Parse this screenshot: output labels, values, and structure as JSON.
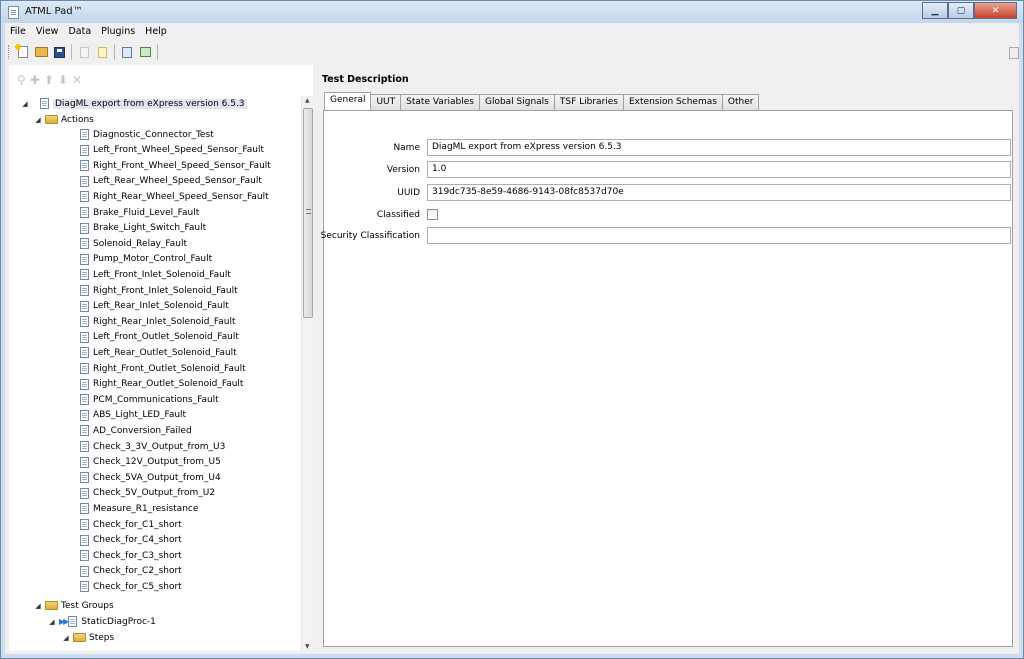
{
  "window": {
    "title": "ATML Pad™"
  },
  "menu": [
    "File",
    "View",
    "Data",
    "Plugins",
    "Help"
  ],
  "toolbar_icons": [
    "new-icon",
    "open-icon",
    "save-icon",
    "document-icon",
    "note-icon",
    "validate-icon",
    "check-icon"
  ],
  "tree_toolbar_icons": [
    "pin-icon",
    "add-icon",
    "move-up-icon",
    "move-down-icon",
    "delete-icon"
  ],
  "tree": {
    "root": "DiagML export from eXpress version 6.5.3",
    "actions_label": "Actions",
    "actions": [
      "Diagnostic_Connector_Test",
      "Left_Front_Wheel_Speed_Sensor_Fault",
      "Right_Front_Wheel_Speed_Sensor_Fault",
      "Left_Rear_Wheel_Speed_Sensor_Fault",
      "Right_Rear_Wheel_Speed_Sensor_Fault",
      "Brake_Fluid_Level_Fault",
      "Brake_Light_Switch_Fault",
      "Solenoid_Relay_Fault",
      "Pump_Motor_Control_Fault",
      "Left_Front_Inlet_Solenoid_Fault",
      "Right_Front_Inlet_Solenoid_Fault",
      "Left_Rear_Inlet_Solenoid_Fault",
      "Right_Rear_Inlet_Solenoid_Fault",
      "Left_Front_Outlet_Solenoid_Fault",
      "Left_Rear_Outlet_Solenoid_Fault",
      "Right_Front_Outlet_Solenoid_Fault",
      "Right_Rear_Outlet_Solenoid_Fault",
      "PCM_Communications_Fault",
      "ABS_Light_LED_Fault",
      "AD_Conversion_Failed",
      "Check_3_3V_Output_from_U3",
      "Check_12V_Output_from_U5",
      "Check_5VA_Output_from_U4",
      "Check_5V_Output_from_U2",
      "Measure_R1_resistance",
      "Check_for_C1_short",
      "Check_for_C4_short",
      "Check_for_C3_short",
      "Check_for_C2_short",
      "Check_for_C5_short"
    ],
    "test_groups_label": "Test Groups",
    "group_item": "StaticDiagProc-1",
    "steps_label": "Steps"
  },
  "detail": {
    "section_title": "Test Description",
    "tabs": [
      "General",
      "UUT",
      "State Variables",
      "Global Signals",
      "TSF Libraries",
      "Extension Schemas",
      "Other"
    ],
    "active_tab": "General",
    "fields": {
      "name_label": "Name",
      "name_value": "DiagML export from eXpress version 6.5.3",
      "version_label": "Version",
      "version_value": "1.0",
      "uuid_label": "UUID",
      "uuid_value": "319dc735-8e59-4686-9143-08fc8537d70e",
      "classified_label": "Classified",
      "classified_checked": false,
      "security_label": "Security Classification",
      "security_value": ""
    }
  }
}
